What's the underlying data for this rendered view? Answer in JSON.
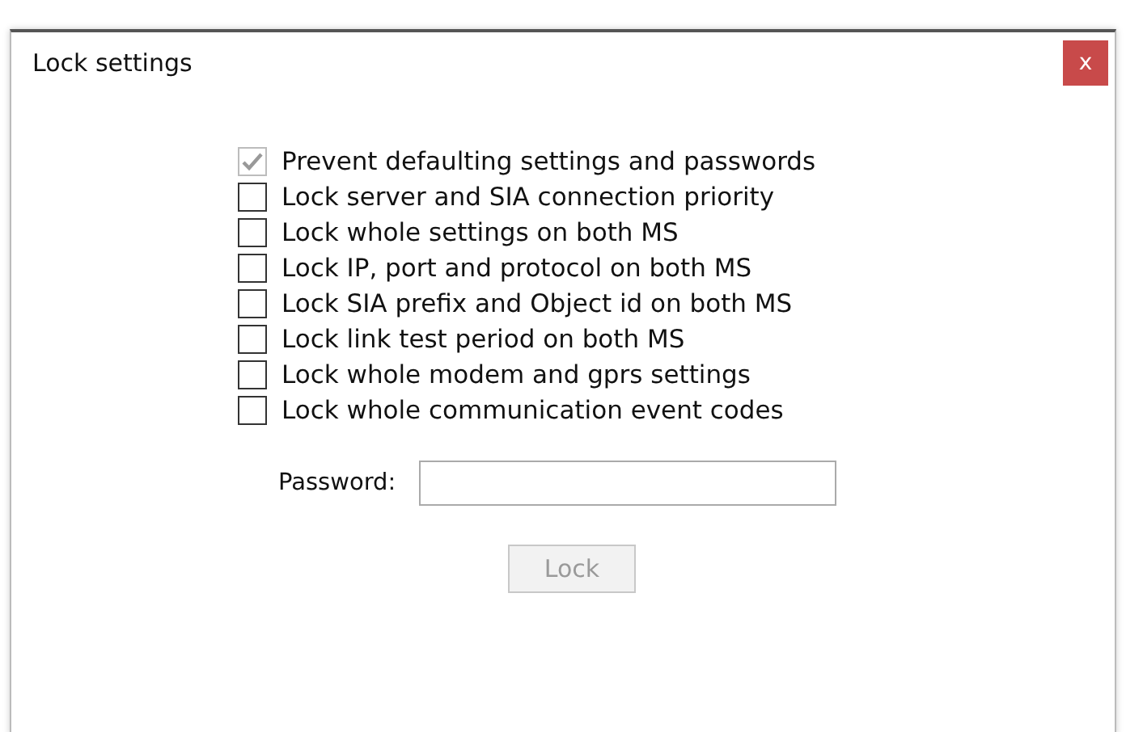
{
  "window": {
    "title": "Lock settings",
    "close": "x"
  },
  "options": [
    {
      "label": "Prevent defaulting settings and passwords",
      "checked": true,
      "disabled": true
    },
    {
      "label": "Lock server and SIA connection priority",
      "checked": false,
      "disabled": false
    },
    {
      "label": "Lock whole settings on both MS",
      "checked": false,
      "disabled": false
    },
    {
      "label": "Lock IP, port and protocol on both MS",
      "checked": false,
      "disabled": false
    },
    {
      "label": "Lock SIA prefix and Object id on both MS",
      "checked": false,
      "disabled": false
    },
    {
      "label": "Lock link test period on both MS",
      "checked": false,
      "disabled": false
    },
    {
      "label": "Lock whole modem and gprs settings",
      "checked": false,
      "disabled": false
    },
    {
      "label": "Lock whole communication event codes",
      "checked": false,
      "disabled": false
    }
  ],
  "password": {
    "label": "Password:"
  },
  "lock_button": {
    "label": "Lock",
    "disabled": true
  }
}
